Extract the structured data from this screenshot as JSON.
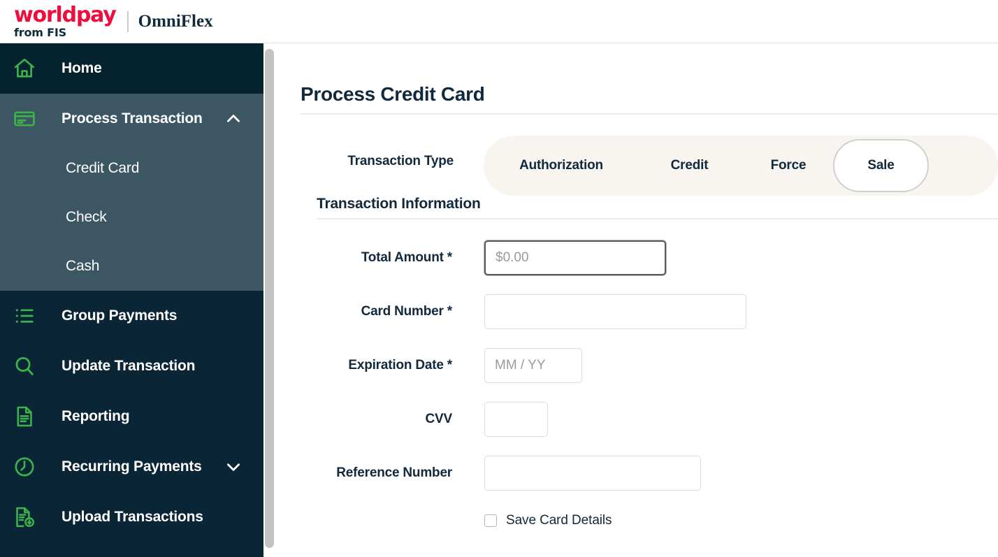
{
  "brand": {
    "worldpay": "worldpay",
    "from_fis": "from FIS",
    "product": "OmniFlex",
    "accent_red": "#ec0e3c",
    "navy": "#0f2b3d"
  },
  "sidebar": {
    "bg": "#0a2636",
    "active_bg": "#05222f",
    "expanded_bg": "#3c5663",
    "icon_green": "#3cb24a",
    "items": [
      {
        "label": "Home",
        "icon": "home-icon",
        "state": "active",
        "expandable": false
      },
      {
        "label": "Process Transaction",
        "icon": "credit-card-icon",
        "state": "expanded",
        "expandable": true,
        "chevron": "chevron-up-icon"
      },
      {
        "label": "Group Payments",
        "icon": "list-icon",
        "state": "normal",
        "expandable": false
      },
      {
        "label": "Update Transaction",
        "icon": "search-icon",
        "state": "normal",
        "expandable": false
      },
      {
        "label": "Reporting",
        "icon": "document-icon",
        "state": "normal",
        "expandable": false
      },
      {
        "label": "Recurring Payments",
        "icon": "clock-icon",
        "state": "normal",
        "expandable": true,
        "chevron": "chevron-down-icon"
      },
      {
        "label": "Upload Transactions",
        "icon": "document-upload-icon",
        "state": "normal",
        "expandable": false
      }
    ],
    "submenu": [
      {
        "label": "Credit Card"
      },
      {
        "label": "Check"
      },
      {
        "label": "Cash"
      }
    ]
  },
  "main": {
    "page_title": "Process Credit Card",
    "transaction_type": {
      "label": "Transaction Type",
      "options": [
        "Authorization",
        "Credit",
        "Force",
        "Sale"
      ],
      "selected": "Sale",
      "group_bg": "#f8f5f1"
    },
    "section_title": "Transaction Information",
    "fields": [
      {
        "label": "Total Amount *",
        "value": "",
        "placeholder": "$0.00",
        "focused": true
      },
      {
        "label": "Card Number *",
        "value": "",
        "placeholder": "",
        "focused": false
      },
      {
        "label": "Expiration Date *",
        "value": "",
        "placeholder": "MM / YY",
        "focused": false
      },
      {
        "label": "CVV",
        "value": "",
        "placeholder": "",
        "focused": false
      },
      {
        "label": "Reference Number",
        "value": "",
        "placeholder": "",
        "focused": false
      }
    ],
    "save_card": {
      "label": "Save Card Details",
      "checked": false
    }
  }
}
